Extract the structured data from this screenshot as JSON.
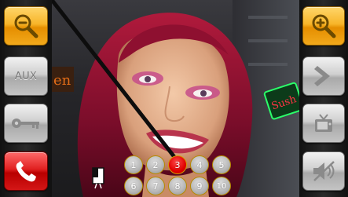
{
  "left_panel": {
    "zoom_out": {
      "icon": "zoom-out-icon"
    },
    "aux": {
      "label": "AUX"
    },
    "key": {
      "icon": "key-icon"
    },
    "hangup": {
      "icon": "phone-hangup-icon"
    }
  },
  "right_panel": {
    "zoom_in": {
      "icon": "zoom-in-icon"
    },
    "next": {
      "icon": "chevron-right-icon"
    },
    "tv": {
      "icon": "tv-icon"
    },
    "mute": {
      "icon": "speaker-mute-icon"
    }
  },
  "video": {
    "sign_text": "Sush"
  },
  "keypad": {
    "selected": "3",
    "keys": [
      "1",
      "2",
      "3",
      "4",
      "5",
      "6",
      "7",
      "8",
      "9",
      "10"
    ]
  },
  "colors": {
    "accent_orange": "#f7b52a",
    "hangup_red": "#e02020",
    "key_selected": "#e00000",
    "key_border": "#b58a00"
  }
}
